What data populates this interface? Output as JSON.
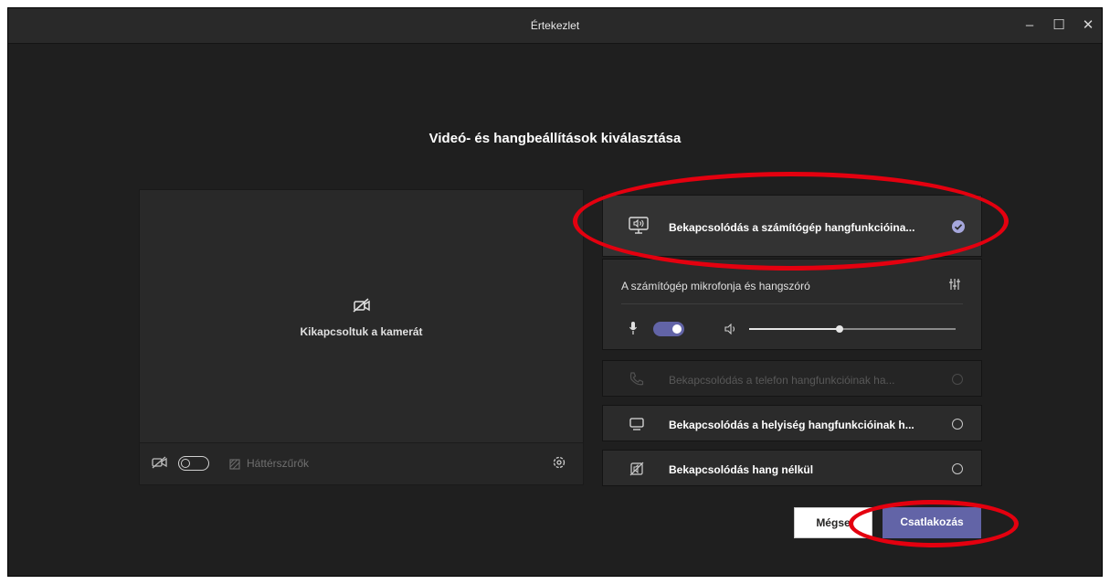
{
  "window": {
    "title": "Értekezlet",
    "minimize_glyph": "–",
    "maximize_glyph": "☐",
    "close_glyph": "✕"
  },
  "heading": "Videó- és hangbeállítások kiválasztása",
  "video": {
    "status_text": "Kikapcsoltuk a kamerát",
    "camera_enabled": false,
    "background_filters_label": "Háttérszűrők"
  },
  "audio": {
    "options": [
      {
        "label": "Bekapcsolódás a számítógép hangfunkcióina...",
        "icon": "computer-audio-icon",
        "selected": true,
        "disabled": false
      },
      {
        "label": "Bekapcsolódás a telefon hangfunkcióinak ha...",
        "icon": "phone-audio-icon",
        "selected": false,
        "disabled": true
      },
      {
        "label": "Bekapcsolódás a helyiség hangfunkcióinak h...",
        "icon": "room-audio-icon",
        "selected": false,
        "disabled": false
      },
      {
        "label": "Bekapcsolódás hang nélkül",
        "icon": "no-audio-icon",
        "selected": false,
        "disabled": false
      }
    ],
    "device_label": "A számítógép mikrofonja és hangszóró",
    "mic_enabled": true,
    "speaker_volume": 0.44
  },
  "buttons": {
    "cancel_label": "Mégse",
    "join_label": "Csatlakozás"
  },
  "colors": {
    "accent": "#6264a7",
    "annotation_red": "#e4000f"
  }
}
